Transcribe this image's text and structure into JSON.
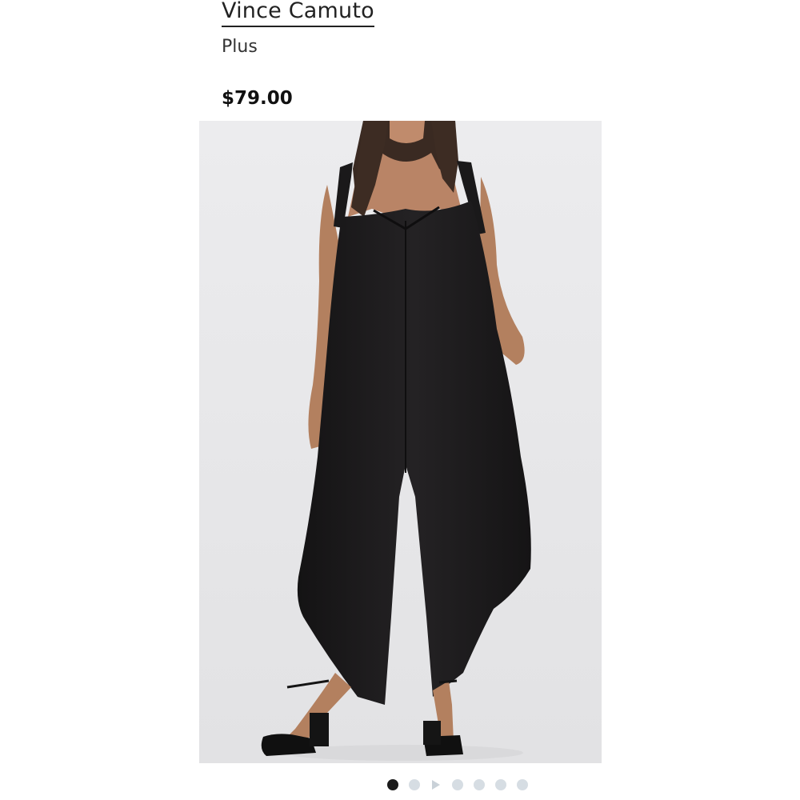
{
  "product": {
    "brand": "Vince Camuto",
    "size_category": "Plus",
    "price": "$79.00"
  },
  "image": {
    "icon": "product-photo-jumpsuit",
    "colors": {
      "background": "#e8e8ea",
      "garment": "#1c1b1c",
      "skin": "#b98466",
      "hair": "#3a2a22"
    }
  },
  "carousel": {
    "total_items": 7,
    "active_index": 0,
    "video_item_index": 2,
    "active_color": "#1a1a1a",
    "inactive_color": "#d6dde3"
  }
}
